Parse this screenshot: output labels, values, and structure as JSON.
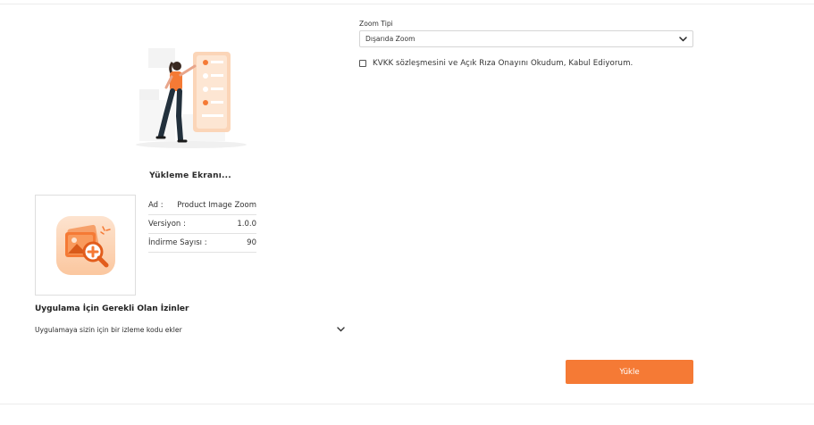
{
  "loading": {
    "title": "Yükleme Ekranı..."
  },
  "app_info": {
    "name_label": "Ad :",
    "name_value": "Product Image Zoom",
    "version_label": "Versiyon :",
    "version_value": "1.0.0",
    "downloads_label": "İndirme Sayısı :",
    "downloads_value": "90"
  },
  "permissions": {
    "title": "Uygulama İçin Gerekli Olan İzinler",
    "items": [
      {
        "label": "Uygulamaya sizin için bir izleme kodu ekler"
      }
    ]
  },
  "settings": {
    "zoom_type_label": "Zoom Tipi",
    "zoom_type_value": "Dışarıda Zoom"
  },
  "consent": {
    "label": "KVKK sözleşmesini ve Açık Rıza Onayını Okudum, Kabul Ediyorum."
  },
  "actions": {
    "upload_label": "Yükle"
  },
  "colors": {
    "accent": "#f57a35",
    "icon_bg": "#fbd7bf",
    "border": "#dedede"
  },
  "icons": {
    "illustration": "woman-checklist-illustration",
    "app_icon": "image-zoom-icon",
    "dropdown": "chevron-down-icon",
    "checkbox": "checkbox-unchecked"
  }
}
